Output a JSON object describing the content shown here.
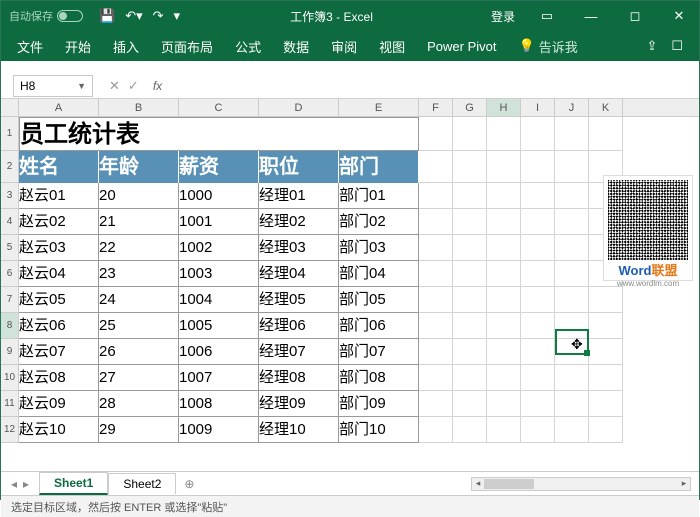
{
  "titlebar": {
    "autosave": "自动保存",
    "title": "工作簿3 - Excel",
    "login": "登录"
  },
  "ribbon": {
    "tabs": [
      "文件",
      "开始",
      "插入",
      "页面布局",
      "公式",
      "数据",
      "审阅",
      "视图",
      "Power Pivot"
    ],
    "tell": "告诉我"
  },
  "namebox": "H8",
  "table": {
    "title": "员工统计表",
    "headers": [
      "姓名",
      "年龄",
      "薪资",
      "职位",
      "部门"
    ],
    "rows": [
      [
        "赵云01",
        "20",
        "1000",
        "经理01",
        "部门01"
      ],
      [
        "赵云02",
        "21",
        "1001",
        "经理02",
        "部门02"
      ],
      [
        "赵云03",
        "22",
        "1002",
        "经理03",
        "部门03"
      ],
      [
        "赵云04",
        "23",
        "1003",
        "经理04",
        "部门04"
      ],
      [
        "赵云05",
        "24",
        "1004",
        "经理05",
        "部门05"
      ],
      [
        "赵云06",
        "25",
        "1005",
        "经理06",
        "部门06"
      ],
      [
        "赵云07",
        "26",
        "1006",
        "经理07",
        "部门07"
      ],
      [
        "赵云08",
        "27",
        "1007",
        "经理08",
        "部门08"
      ],
      [
        "赵云09",
        "28",
        "1008",
        "经理09",
        "部门09"
      ],
      [
        "赵云10",
        "29",
        "1009",
        "经理10",
        "部门10"
      ]
    ]
  },
  "ext_cols": [
    "F",
    "G",
    "H",
    "I",
    "J",
    "K"
  ],
  "sheets": {
    "s1": "Sheet1",
    "s2": "Sheet2"
  },
  "status": "选定目标区域，然后按 ENTER 或选择\"粘贴\"",
  "watermark": {
    "brand": "Word",
    "brand2": "联盟",
    "url": "www.wordlm.com"
  }
}
